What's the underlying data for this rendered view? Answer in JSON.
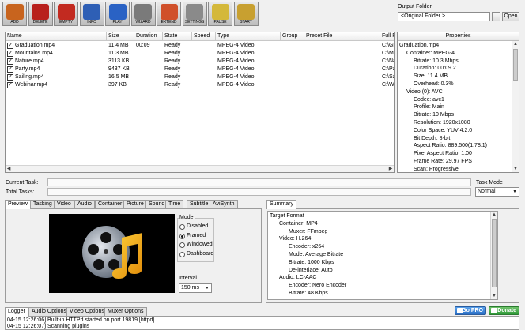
{
  "toolbar": [
    {
      "label": "ADD",
      "icon": "add-icon",
      "color": "#c8641e"
    },
    {
      "label": "DELETE",
      "icon": "delete-icon",
      "color": "#b8201c"
    },
    {
      "label": "EMPTY",
      "icon": "empty-icon",
      "color": "#c22a20"
    },
    {
      "label": "INFO",
      "icon": "info-icon",
      "color": "#2e5fb5"
    },
    {
      "label": "PLAY",
      "icon": "play-icon",
      "color": "#2a62c4"
    },
    {
      "label": "WIZARD",
      "icon": "wizard-icon",
      "color": "#7a7a7a"
    },
    {
      "label": "EXTEND",
      "icon": "extend-icon",
      "color": "#d0502a"
    },
    {
      "label": "SETTINGS",
      "icon": "settings-icon",
      "color": "#8a8a8a"
    },
    {
      "label": "PAUSE",
      "icon": "pause-icon",
      "color": "#d4b83a"
    },
    {
      "label": "START",
      "icon": "start-icon",
      "color": "#c8a030"
    }
  ],
  "output": {
    "label": "Output Folder",
    "value": "<Original Folder >",
    "browse": "...",
    "open": "Open"
  },
  "columns": [
    "Name",
    "Size",
    "Duration",
    "State",
    "Speed",
    "Type",
    "Group",
    "Preset File",
    "Full Pa"
  ],
  "files": [
    {
      "name": "Graduation.mp4",
      "size": "11.4 MB",
      "duration": "00:09",
      "state": "Ready",
      "speed": "",
      "type": "MPEG-4 Video",
      "group": "",
      "preset": "",
      "path": "C:\\Gr"
    },
    {
      "name": "Mountains.mp4",
      "size": "11.3 MB",
      "duration": "",
      "state": "Ready",
      "speed": "",
      "type": "MPEG-4 Video",
      "group": "",
      "preset": "",
      "path": "C:\\Mo"
    },
    {
      "name": "Nature.mp4",
      "size": "3113 KB",
      "duration": "",
      "state": "Ready",
      "speed": "",
      "type": "MPEG-4 Video",
      "group": "",
      "preset": "",
      "path": "C:\\Na"
    },
    {
      "name": "Party.mp4",
      "size": "9437 KB",
      "duration": "",
      "state": "Ready",
      "speed": "",
      "type": "MPEG-4 Video",
      "group": "",
      "preset": "",
      "path": "C:\\Pa"
    },
    {
      "name": "Sailing.mp4",
      "size": "16.5 MB",
      "duration": "",
      "state": "Ready",
      "speed": "",
      "type": "MPEG-4 Video",
      "group": "",
      "preset": "",
      "path": "C:\\Sai"
    },
    {
      "name": "Webinar.mp4",
      "size": "397 KB",
      "duration": "",
      "state": "Ready",
      "speed": "",
      "type": "MPEG-4 Video",
      "group": "",
      "preset": "",
      "path": "C:\\We"
    }
  ],
  "properties": {
    "header": "Properties",
    "lines": [
      {
        "text": "Graduation.mp4",
        "indent": 0
      },
      {
        "text": "Container: MPEG-4",
        "indent": 1
      },
      {
        "text": "Bitrate: 10.3 Mbps",
        "indent": 2
      },
      {
        "text": "Duration: 00:09.2",
        "indent": 2
      },
      {
        "text": "Size: 11.4 MB",
        "indent": 2
      },
      {
        "text": "Overhead: 0.3%",
        "indent": 2
      },
      {
        "text": "Video (0): AVC",
        "indent": 1
      },
      {
        "text": "Codec: avc1",
        "indent": 2
      },
      {
        "text": "Profile: Main",
        "indent": 2
      },
      {
        "text": "Bitrate: 10 Mbps",
        "indent": 2
      },
      {
        "text": "Resolution: 1920x1080",
        "indent": 2
      },
      {
        "text": "Color Space: YUV 4:2:0",
        "indent": 2
      },
      {
        "text": "Bit Depth: 8-bit",
        "indent": 2
      },
      {
        "text": "Aspect Ratio: 889:500(1.78:1)",
        "indent": 2
      },
      {
        "text": "Pixel Aspect Ratio: 1.00",
        "indent": 2
      },
      {
        "text": "Frame Rate: 29.97 FPS",
        "indent": 2
      },
      {
        "text": "Scan: Progressive",
        "indent": 2
      }
    ]
  },
  "tasks": {
    "current": "Current Task:",
    "total": "Total Tasks:",
    "mode_label": "Task Mode",
    "mode_value": "Normal"
  },
  "tabs": [
    "Preview",
    "Tasking",
    "Video",
    "Audio",
    "Container",
    "Picture",
    "Sound",
    "Time",
    "Subtitle",
    "AviSynth"
  ],
  "mode": {
    "label": "Mode",
    "options": [
      "Disabled",
      "Framed",
      "Windowed",
      "Dashboard"
    ],
    "selected": "Framed"
  },
  "interval": {
    "label": "Interval",
    "value": "150 ms"
  },
  "summary": {
    "tab": "Summary",
    "lines": [
      {
        "text": "Target Format",
        "indent": 0
      },
      {
        "text": "Container: MP4",
        "indent": 1
      },
      {
        "text": "Muxer: FFmpeg",
        "indent": 2
      },
      {
        "text": "Video: H.264",
        "indent": 1
      },
      {
        "text": "Encoder: x264",
        "indent": 2
      },
      {
        "text": "Mode: Average Bitrate",
        "indent": 2
      },
      {
        "text": "Bitrate: 1000 Kbps",
        "indent": 2
      },
      {
        "text": "De-interlace: Auto",
        "indent": 2
      },
      {
        "text": "Audio: LC-AAC",
        "indent": 1
      },
      {
        "text": "Encoder: Nero Encoder",
        "indent": 2
      },
      {
        "text": "Bitrate: 48 Kbps",
        "indent": 2
      }
    ]
  },
  "bottom_tabs": [
    "Logger",
    "Audio Options",
    "Video Options",
    "Muxer Options"
  ],
  "gopro": "Go PRO",
  "donate": "Donate",
  "log": [
    "04-15 12:26:06] Built-in HTTPd started on port 19819 [httpd]",
    "04-15 12:26:07] Scanning plugins"
  ]
}
